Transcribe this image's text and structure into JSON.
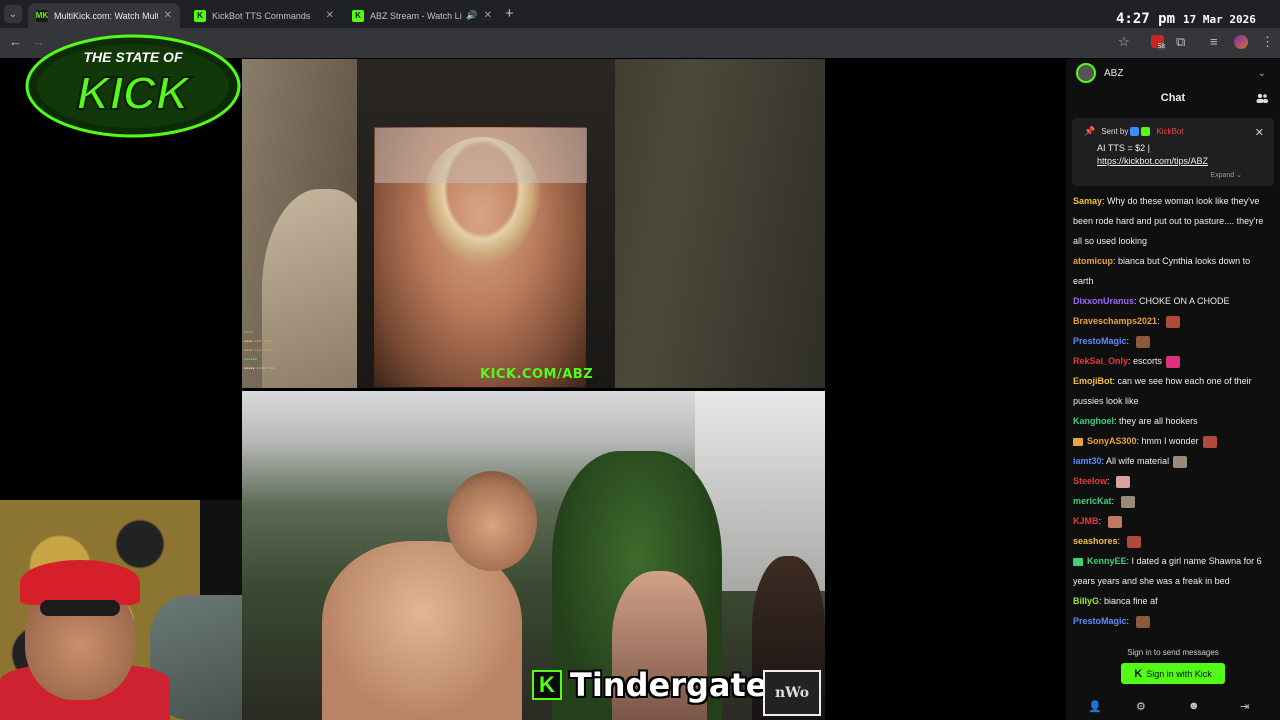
{
  "browser": {
    "tabs": [
      {
        "title": "MultiKick.com: Watch Multiple",
        "favicon": "MK",
        "active": true
      },
      {
        "title": "KickBot TTS Commands",
        "favicon": "K",
        "active": false
      },
      {
        "title": "ABZ Stream - Watch Live on",
        "favicon": "K",
        "active": false,
        "audio": true
      }
    ],
    "clock_time": "4:27 pm",
    "clock_date": "17 Mar 2026",
    "ext_badge": "58"
  },
  "overlay": {
    "logo_top": "THE STATE OF",
    "logo_main": "KICK"
  },
  "stream_top": {
    "watermark": "KICK.COM/ABZ"
  },
  "stream_bottom": {
    "caption": "Tindergate",
    "caption_badge": "K",
    "corner_logo": "nWo"
  },
  "chat": {
    "channel": "ABZ",
    "title": "Chat",
    "pinned": {
      "sent_by": "Sent by",
      "sender": "KickBot",
      "line1": "AI TTS = $2 |",
      "link": "https://kickbot.com/tips/ABZ",
      "expand": "Expand"
    },
    "messages": [
      {
        "user": "Samay",
        "color": "#f0c040",
        "text": "Why do these woman look like they've been rode hard and put out to pasture.... they're all so used looking"
      },
      {
        "user": "atomicup",
        "color": "#e8a33c",
        "text": "bianca but Cynthia looks down to earth"
      },
      {
        "user": "DixxonUranus",
        "color": "#9b6bff",
        "text": "CHOKE ON A CHODE"
      },
      {
        "user": "Braveschamps2021",
        "color": "#e8a33c",
        "text": "",
        "emote": "#b04a3a"
      },
      {
        "user": "PrestoMagic",
        "color": "#5a8cff",
        "text": "",
        "emote": "#8a5a3a"
      },
      {
        "user": "RekSai_Only",
        "color": "#e23b3b",
        "text": "escorts",
        "emote": "#e03080"
      },
      {
        "user": "EmojiBot",
        "color": "#f0c040",
        "text": "can we see how each one of their pussies look like"
      },
      {
        "user": "Kanghoel",
        "color": "#3fd07a",
        "text": "they are all hookers"
      },
      {
        "user": "SonyAS300",
        "color": "#e8a33c",
        "text": "hmm I wonder",
        "emote": "#b04a3a",
        "sub": true
      },
      {
        "user": "iamt30",
        "color": "#5a8cff",
        "text": "All wife material",
        "emote": "#9a8a7a"
      },
      {
        "user": "Steelow",
        "color": "#e23b3b",
        "text": "",
        "emote": "#d8a0a0"
      },
      {
        "user": "mericKat",
        "color": "#3fd07a",
        "text": "",
        "emote": "#9a8a7a"
      },
      {
        "user": "KJMB",
        "color": "#e23b3b",
        "text": "",
        "emote": "#c07a60"
      },
      {
        "user": "seashores",
        "color": "#f0c040",
        "text": "",
        "emote": "#b04a3a"
      },
      {
        "user": "KennyEE",
        "color": "#3fd07a",
        "text": "I dated a girl name Shawna for 6 years years and she was a freak in bed",
        "sub": true
      },
      {
        "user": "BillyG",
        "color": "#9be34a",
        "text": "bianca fine af"
      },
      {
        "user": "PrestoMagic",
        "color": "#5a8cff",
        "text": "",
        "emote": "#8a5a3a"
      }
    ],
    "signin_prompt": "Sign in to send messages",
    "signin_button": "Sign in with Kick"
  }
}
